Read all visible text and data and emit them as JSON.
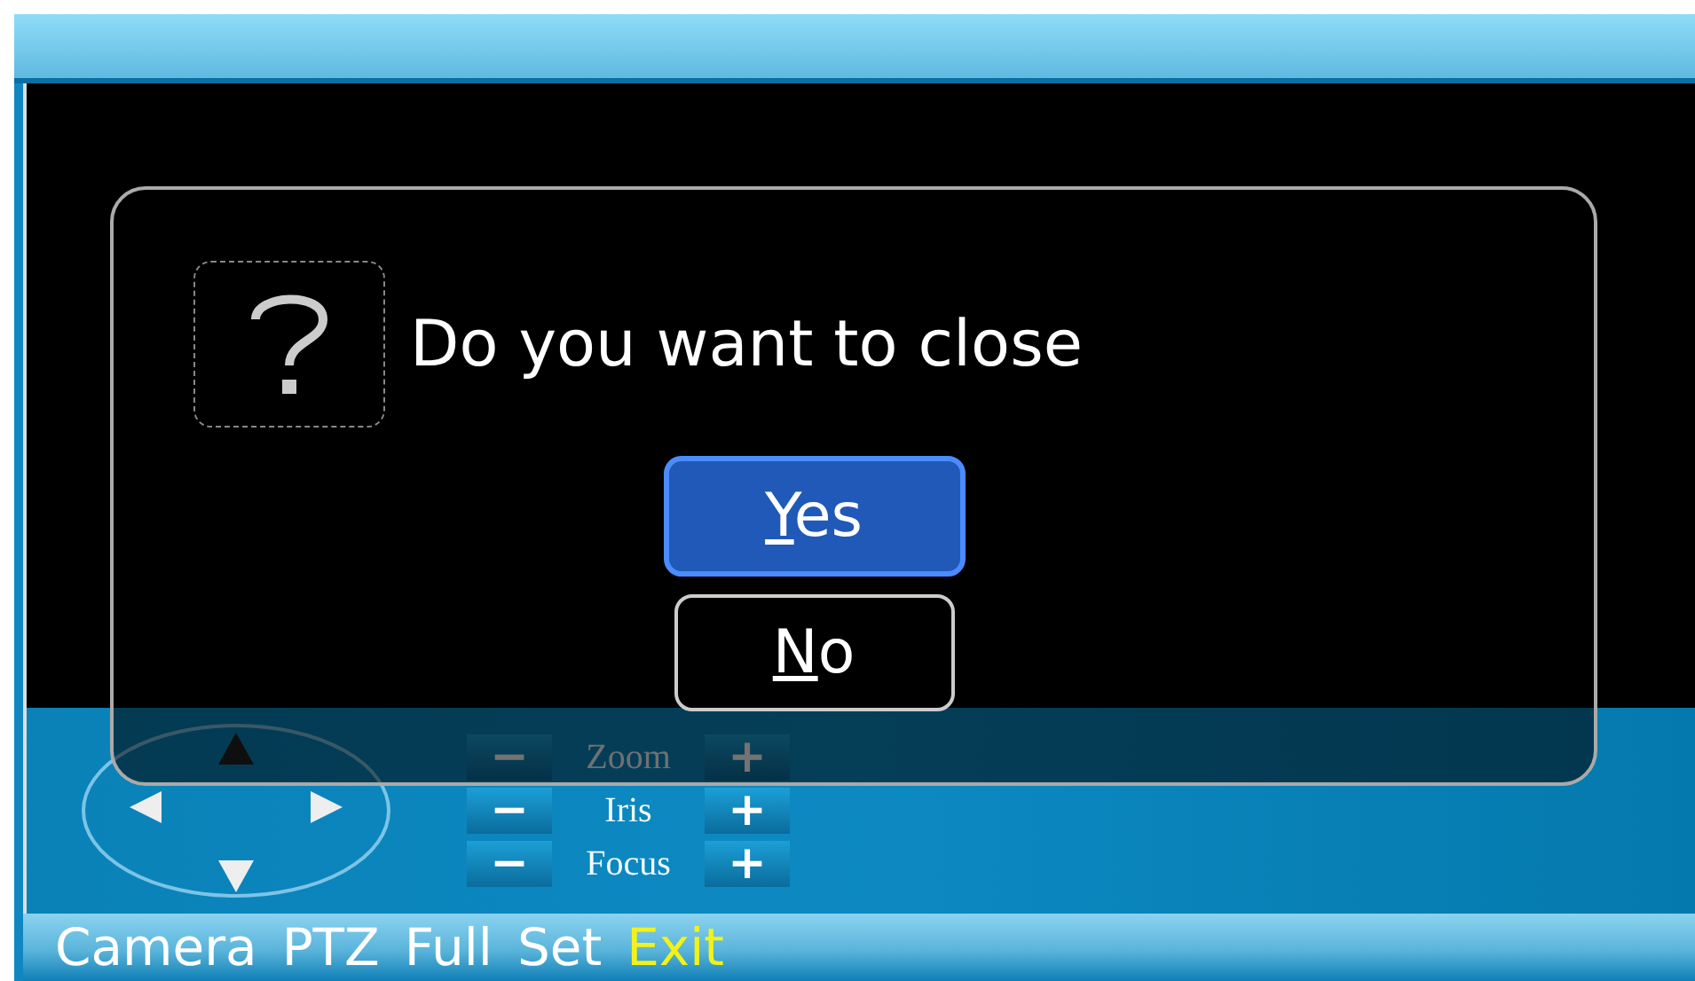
{
  "dialog": {
    "message": "Do you want to close",
    "buttons": [
      {
        "mnemonic": "Y",
        "rest": "es",
        "selected": true
      },
      {
        "mnemonic": "N",
        "rest": "o",
        "selected": false
      }
    ]
  },
  "ptz": {
    "rows": [
      {
        "minus": "−",
        "label": "Zoom",
        "plus": "+"
      },
      {
        "minus": "−",
        "label": "Iris",
        "plus": "+"
      },
      {
        "minus": "−",
        "label": "Focus",
        "plus": "+"
      }
    ]
  },
  "menu": [
    {
      "label": "Camera",
      "selected": false
    },
    {
      "label": "PTZ",
      "selected": false
    },
    {
      "label": "Full",
      "selected": false
    },
    {
      "label": "Set",
      "selected": false
    },
    {
      "label": "Exit",
      "selected": true
    }
  ]
}
